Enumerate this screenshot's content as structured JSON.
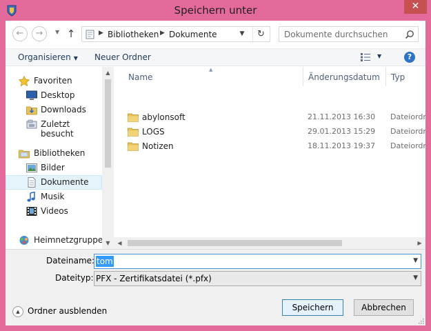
{
  "window": {
    "title": "Speichern unter",
    "close_label": "✕"
  },
  "address": {
    "crumbs": [
      "Bibliotheken",
      "Dokumente"
    ],
    "search_placeholder": "Dokumente durchsuchen"
  },
  "toolbar": {
    "organize_label": "Organisieren",
    "new_folder_label": "Neuer Ordner",
    "help_label": "?"
  },
  "navigation": {
    "groups": [
      {
        "label": "Favoriten",
        "icon": "star-icon",
        "items": [
          {
            "label": "Desktop",
            "icon": "desktop-icon"
          },
          {
            "label": "Downloads",
            "icon": "downloads-icon"
          },
          {
            "label": "Zuletzt besucht",
            "icon": "recent-places-icon"
          }
        ]
      },
      {
        "label": "Bibliotheken",
        "icon": "libraries-icon",
        "items": [
          {
            "label": "Bilder",
            "icon": "pictures-icon"
          },
          {
            "label": "Dokumente",
            "icon": "documents-icon",
            "selected": true
          },
          {
            "label": "Musik",
            "icon": "music-icon"
          },
          {
            "label": "Videos",
            "icon": "videos-icon"
          }
        ]
      },
      {
        "label": "Heimnetzgruppe",
        "icon": "homegroup-icon",
        "items": []
      }
    ]
  },
  "file_list": {
    "columns": [
      "Name",
      "Änderungsdatum",
      "Typ"
    ],
    "rows": [
      {
        "name": "abylonsoft",
        "date": "21.11.2013 16:30",
        "type": "Dateiordner"
      },
      {
        "name": "LOGS",
        "date": "29.01.2013 15:29",
        "type": "Dateiordner"
      },
      {
        "name": "Notizen",
        "date": "18.11.2013 19:37",
        "type": "Dateiordner"
      }
    ]
  },
  "form": {
    "filename_label": "Dateiname:",
    "filename_value": "tom",
    "filetype_label": "Dateityp:",
    "filetype_value": "PFX - Zertifikatsdatei (*.pfx)"
  },
  "footer": {
    "hide_folders_label": "Ordner ausblenden",
    "save_label": "Speichern",
    "cancel_label": "Abbrechen"
  },
  "colors": {
    "window_frame": "#e46a9c",
    "close_button": "#c75050",
    "selection": "#3399ff",
    "nav_selected": "#e5f3fb"
  }
}
